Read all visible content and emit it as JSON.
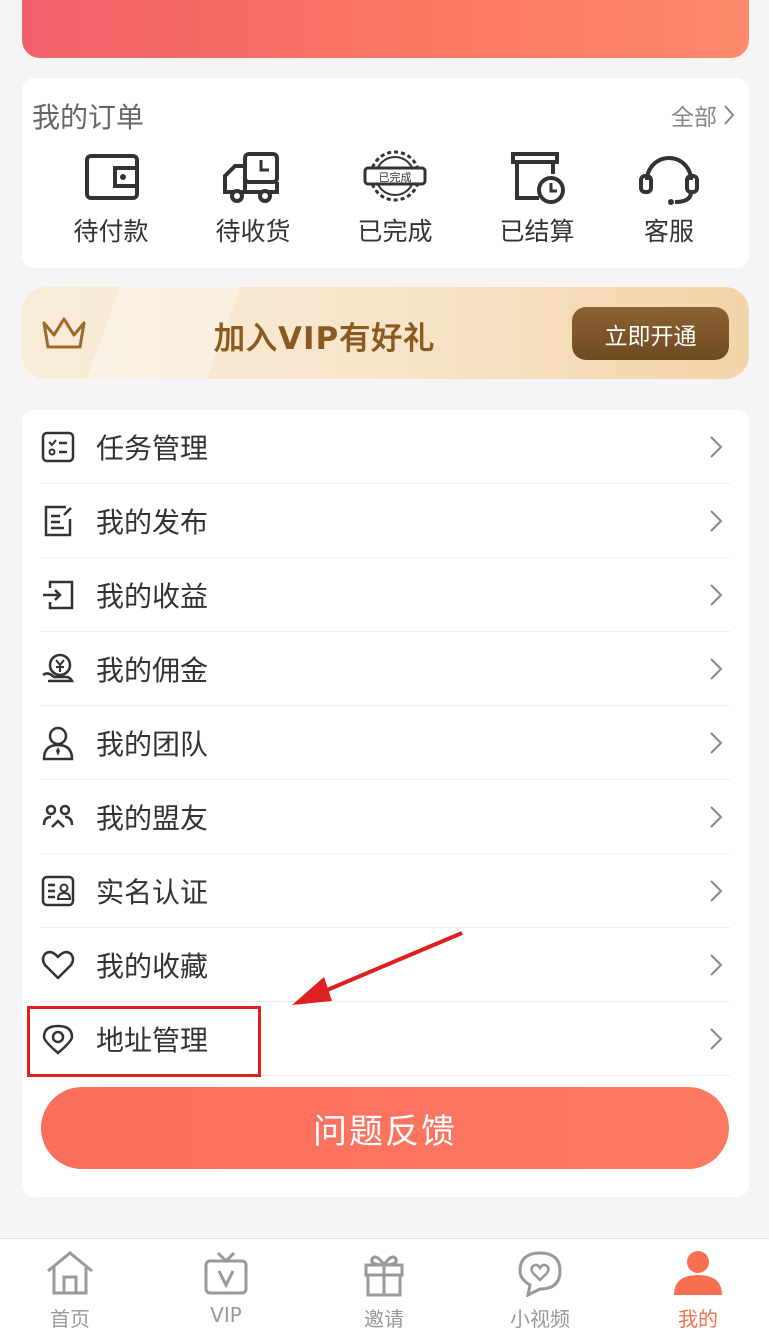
{
  "orders": {
    "title": "我的订单",
    "all_label": "全部",
    "items": [
      {
        "label": "待付款",
        "icon": "wallet-icon"
      },
      {
        "label": "待收货",
        "icon": "truck-icon"
      },
      {
        "label": "已完成",
        "icon": "completed-stamp-icon",
        "stamp_text": "已完成"
      },
      {
        "label": "已结算",
        "icon": "settlement-clock-icon"
      },
      {
        "label": "客服",
        "icon": "headset-icon"
      }
    ]
  },
  "vip": {
    "title": "加入VIP有好礼",
    "button_label": "立即开通",
    "icon": "crown-icon"
  },
  "menu": {
    "items": [
      {
        "label": "任务管理",
        "icon": "task-list-icon"
      },
      {
        "label": "我的发布",
        "icon": "publish-icon"
      },
      {
        "label": "我的收益",
        "icon": "income-icon"
      },
      {
        "label": "我的佣金",
        "icon": "commission-icon"
      },
      {
        "label": "我的团队",
        "icon": "team-icon"
      },
      {
        "label": "我的盟友",
        "icon": "allies-icon"
      },
      {
        "label": "实名认证",
        "icon": "id-card-icon"
      },
      {
        "label": "我的收藏",
        "icon": "heart-icon"
      },
      {
        "label": "地址管理",
        "icon": "location-icon"
      }
    ]
  },
  "feedback_label": "问题反馈",
  "tabs": [
    {
      "label": "首页",
      "icon": "home-icon",
      "active": false
    },
    {
      "label": "VIP",
      "icon": "vip-tv-icon",
      "active": false
    },
    {
      "label": "邀请",
      "icon": "gift-icon",
      "active": false
    },
    {
      "label": "小视频",
      "icon": "video-heart-icon",
      "active": false
    },
    {
      "label": "我的",
      "icon": "profile-icon",
      "active": true
    }
  ],
  "colors": {
    "accent": "#f8704f",
    "vip_brown": "#8a5a1f",
    "annotation_red": "#e02020"
  }
}
